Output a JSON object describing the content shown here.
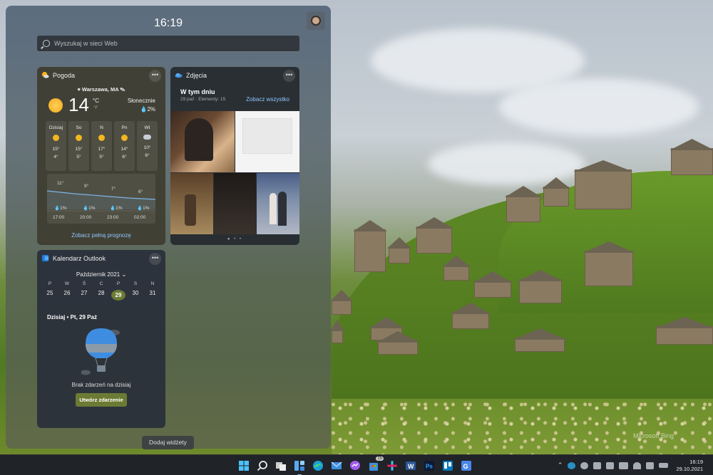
{
  "panel": {
    "time": "16:19",
    "search_placeholder": "Wyszukaj w sieci Web",
    "add_widgets": "Dodaj widżety"
  },
  "weather": {
    "title": "Pogoda",
    "location": "Warszawa, MA",
    "temp": "14",
    "unit_c": "°C",
    "unit_f": "°F",
    "condition": "Słonecznie",
    "rain": "2%",
    "days": [
      {
        "name": "Dzisiaj",
        "icon": "sun-icon",
        "hi": "15°",
        "lo": "4°"
      },
      {
        "name": "So",
        "icon": "sun-icon",
        "hi": "15°",
        "lo": "5°"
      },
      {
        "name": "N",
        "icon": "sun-icon",
        "hi": "17°",
        "lo": "5°"
      },
      {
        "name": "Pn",
        "icon": "sun-icon",
        "hi": "14°",
        "lo": "6°"
      },
      {
        "name": "Wt",
        "icon": "cloud-icon",
        "hi": "10°",
        "lo": "6°"
      }
    ],
    "hourly": [
      {
        "time": "17:00",
        "temp": "11°",
        "rain": "1%"
      },
      {
        "time": "20:00",
        "temp": "9°",
        "rain": "1%"
      },
      {
        "time": "23:00",
        "temp": "7°",
        "rain": "1%"
      },
      {
        "time": "02:00",
        "temp": "6°",
        "rain": "1%"
      }
    ],
    "link": "Zobacz pełną prognozę"
  },
  "photos": {
    "title": "Zdjęcia",
    "heading": "W tym dniu",
    "meta": "29 paź · Elementy: 15",
    "see_all": "Zobacz wszystko",
    "dots": "● • •"
  },
  "calendar": {
    "title": "Kalendarz Outlook",
    "month": "Październik 2021",
    "weekdays": [
      "P",
      "W",
      "Ś",
      "C",
      "P",
      "S",
      "N"
    ],
    "days": [
      "25",
      "26",
      "27",
      "28",
      "29",
      "30",
      "31"
    ],
    "today_index": 4,
    "today_label": "Dzisiaj • Pt, 29 Paź",
    "empty": "Brak zdarzeń na dzisiaj",
    "create": "Utwórz zdarzenie"
  },
  "desktop": {
    "watermark": "Microsoft Bing"
  },
  "taskbar": {
    "apps": [
      "start-icon",
      "search-icon",
      "task-view-icon",
      "widgets-icon",
      "edge-icon",
      "mail-icon",
      "messenger-icon",
      "store-icon",
      "slack-icon",
      "word-icon",
      "photoshop-icon",
      "trello-icon",
      "translate-icon"
    ],
    "badge": "15",
    "clock_time": "16:19",
    "clock_date": "29.10.2021"
  },
  "colors": {
    "accent_link": "#8fc6ff",
    "calendar_accent": "#6b7b34"
  }
}
